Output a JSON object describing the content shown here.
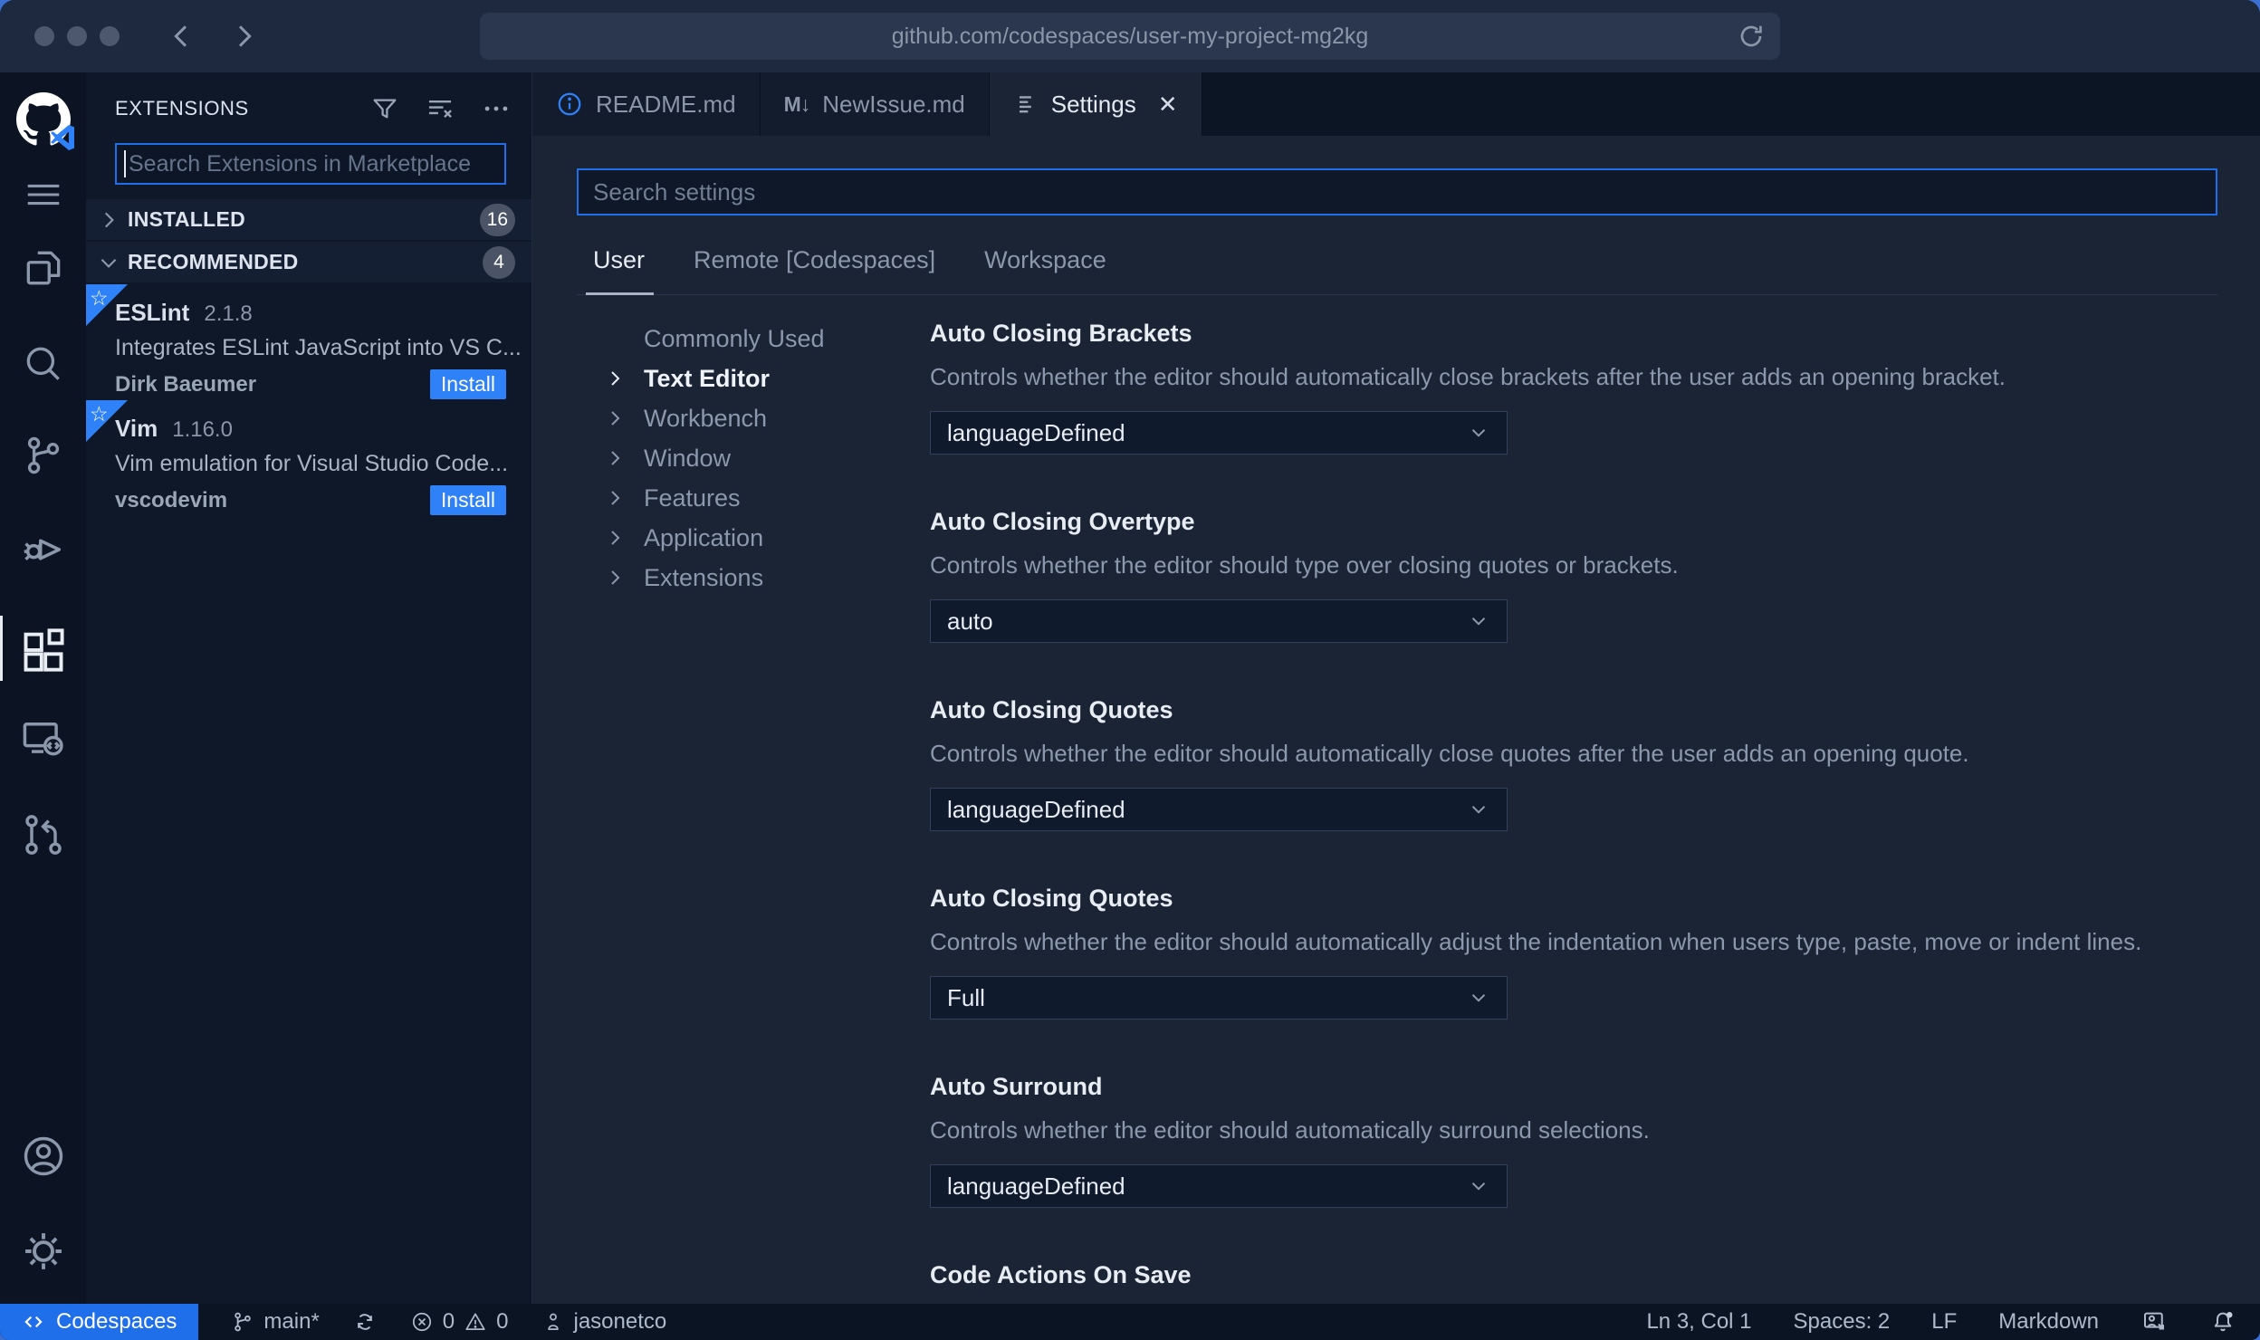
{
  "browser": {
    "url": "github.com/codespaces/user-my-project-mg2kg"
  },
  "activity_bar": {
    "items": [
      "github-codespaces-logo",
      "menu",
      "explorer",
      "search",
      "source-control",
      "run-and-debug",
      "extensions",
      "remote-explorer",
      "github-pull-requests",
      "account",
      "manage-settings"
    ],
    "active": "extensions"
  },
  "sidebar": {
    "title": "EXTENSIONS",
    "search": {
      "placeholder": "Search Extensions in Marketplace",
      "value": ""
    },
    "sections": [
      {
        "label": "INSTALLED",
        "count": "16"
      },
      {
        "label": "RECOMMENDED",
        "count": "4"
      }
    ],
    "extensions": [
      {
        "name": "ESLint",
        "version": "2.1.8",
        "description": "Integrates ESLint JavaScript into VS C...",
        "publisher": "Dirk Baeumer",
        "action_label": "Install"
      },
      {
        "name": "Vim",
        "version": "1.16.0",
        "description": "Vim emulation for Visual Studio Code...",
        "publisher": "vscodevim",
        "action_label": "Install"
      }
    ]
  },
  "editor": {
    "tabs": [
      {
        "label": "README.md"
      },
      {
        "label": "NewIssue.md"
      },
      {
        "label": "Settings"
      }
    ],
    "settings_page": {
      "search": {
        "placeholder": "Search settings",
        "value": ""
      },
      "scope_tabs": [
        {
          "label": "User"
        },
        {
          "label": "Remote [Codespaces]"
        },
        {
          "label": "Workspace"
        }
      ],
      "toc": [
        {
          "label": "Commonly Used"
        },
        {
          "label": "Text Editor"
        },
        {
          "label": "Workbench"
        },
        {
          "label": "Window"
        },
        {
          "label": "Features"
        },
        {
          "label": "Application"
        },
        {
          "label": "Extensions"
        }
      ],
      "items": [
        {
          "title": "Auto Closing Brackets",
          "description": "Controls whether the editor should automatically close brackets after the user adds an opening bracket.",
          "value": "languageDefined"
        },
        {
          "title": "Auto Closing Overtype",
          "description": "Controls whether the editor should type over closing quotes or brackets.",
          "value": "auto"
        },
        {
          "title": "Auto Closing Quotes",
          "description": "Controls whether the editor should automatically close quotes after the user adds an opening quote.",
          "value": "languageDefined"
        },
        {
          "title": "Auto Closing Quotes",
          "description": "Controls whether the editor should automatically adjust the indentation when users type, paste, move or indent lines.",
          "value": "Full"
        },
        {
          "title": "Auto Surround",
          "description": "Controls whether the editor should automatically surround selections.",
          "value": "languageDefined"
        },
        {
          "title": "Code Actions On Save"
        }
      ]
    }
  },
  "status_bar": {
    "codespaces_label": "Codespaces",
    "branch": "main*",
    "errors": "0",
    "warnings": "0",
    "user": "jasonetco",
    "cursor_position": "Ln 3, Col 1",
    "indentation": "Spaces: 2",
    "eol": "LF",
    "language": "Markdown"
  },
  "colors": {
    "accent_blue": "#2f81f7",
    "codespaces_blue": "#1f6feb",
    "editor_bg": "#1a2434",
    "sidebar_bg": "#0e1828",
    "statusbar_bg": "#0b1422",
    "chrome_bg": "#1e2940"
  }
}
